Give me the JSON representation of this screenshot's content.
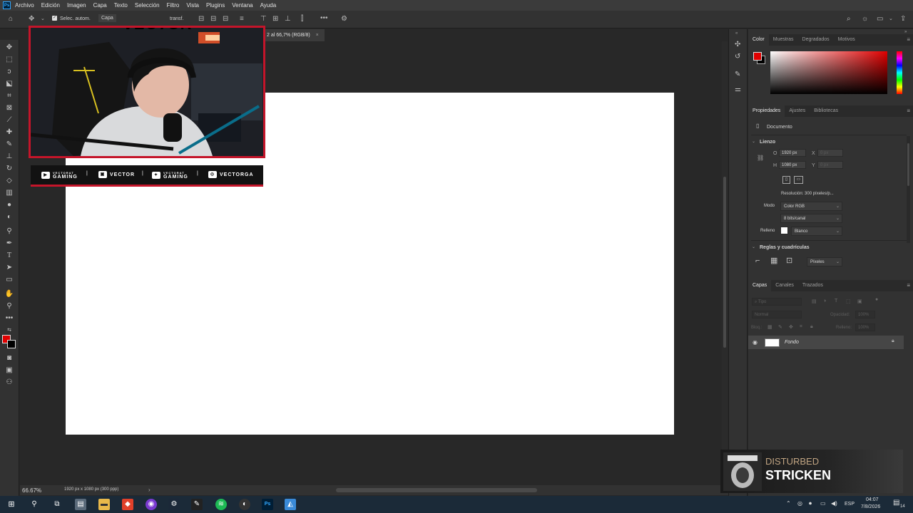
{
  "menubar": {
    "logo": "Ps",
    "items": [
      "Archivo",
      "Edición",
      "Imagen",
      "Capa",
      "Texto",
      "Selección",
      "Filtro",
      "Vista",
      "Plugins",
      "Ventana",
      "Ayuda"
    ]
  },
  "options": {
    "auto_select_label": "Selec. autom.",
    "auto_select_target": "Capa",
    "transform_label": "transf."
  },
  "overlay": {
    "brand": "VECTOR",
    "socials": [
      {
        "icon": "youtube-icon",
        "glyph": "▶",
        "label_top": "VECTORAT",
        "label": "GAMING"
      },
      {
        "icon": "twitch-icon",
        "glyph": "▣",
        "label": "VECTOR"
      },
      {
        "icon": "twitter-icon",
        "glyph": "✦",
        "label_top": "VECTORAT",
        "label": "GAMING"
      },
      {
        "icon": "instagram-icon",
        "glyph": "◎",
        "label": "VECTORGA"
      }
    ],
    "music_artist": "DISTURBED",
    "music_track": "STRICKEN"
  },
  "document": {
    "tab_title": "2 al 66,7% (RGB/8)",
    "close": "×",
    "zoom": "66.67%",
    "dims": "1920 px x 1080 px (300 ppp)"
  },
  "color_panel": {
    "tabs": [
      "Color",
      "Muestras",
      "Degradados",
      "Motivos"
    ],
    "foreground": "#e00000",
    "background": "#000000"
  },
  "properties_panel": {
    "tabs": [
      "Propiedades",
      "Ajustes",
      "Bibliotecas"
    ],
    "type_label": "Documento",
    "section_canvas": "Lienzo",
    "w_label": "O",
    "w_value": "1920 px",
    "h_label": "H",
    "h_value": "1080 px",
    "x_label": "X",
    "x_value": "0 px",
    "y_label": "Y",
    "y_value": "0 px",
    "resolution": "Resolución: 300 píxeles/p...",
    "mode_label": "Modo",
    "mode_value": "Color RGB",
    "bits_value": "8 bits/canal",
    "fill_label": "Relleno",
    "fill_value": "Blanco",
    "section_rulers": "Reglas y cuadrículas",
    "units_value": "Píxeles"
  },
  "layers_panel": {
    "tabs": [
      "Capas",
      "Canales",
      "Trazados"
    ],
    "search_placeholder": "Tipo",
    "blend_mode": "Normal",
    "opacity_label": "Opacidad:",
    "opacity_value": "100%",
    "lock_label": "Bloq.:",
    "fill_label": "Relleno:",
    "fill_value": "100%",
    "layers": [
      {
        "name": "Fondo",
        "visible": true,
        "locked": true
      }
    ]
  },
  "taskbar": {
    "lang": "ESP",
    "time": "04:07",
    "date": "7/8/2026",
    "notifications": "14"
  }
}
